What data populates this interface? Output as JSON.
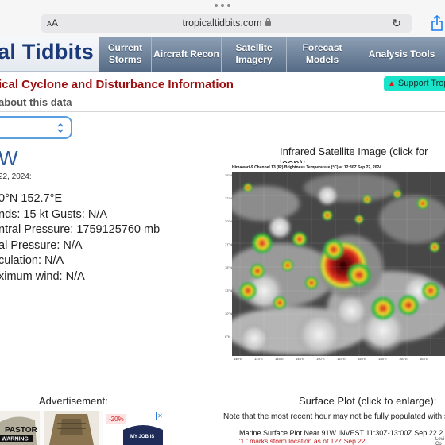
{
  "browser": {
    "aa_label": "AA",
    "url": "tropicaltidbits.com"
  },
  "site": {
    "logo_text": "al Tidbits",
    "nav": [
      {
        "label": "Current Storms"
      },
      {
        "label": "Aircraft Recon"
      },
      {
        "label": "Satellite Imagery"
      },
      {
        "label": "Forecast Models"
      },
      {
        "label": "Analysis Tools"
      }
    ]
  },
  "page": {
    "title": "ical Cyclone and Disturbance Information",
    "support_label": "Support Tropi",
    "about_link": "about this data"
  },
  "storm": {
    "name": "W",
    "as_of": "22, 2024:",
    "lines": [
      "0°N 152.7°E",
      "nds: 15 kt  Gusts: N/A",
      "ntral Pressure: 1759125760 mb",
      "al Pressure: N/A",
      "culation: N/A",
      "ximum wind: N/A"
    ]
  },
  "satellite": {
    "caption": "Infrared Satellite Image (click for loop):",
    "header": "Himawari-9 Channel 13 (IR) Brightness Temperature (°C) at 12:30Z Sep 22, 2024",
    "lat_labels": [
      "25°N",
      "22°N",
      "20°N",
      "17°N",
      "15°N",
      "13°N",
      "10°N",
      "8°N",
      "5°N"
    ],
    "lon_labels": [
      "140°E",
      "143°E",
      "145°E",
      "148°E",
      "150°E",
      "153°E",
      "155°E",
      "158°E",
      "160°E",
      "163°E",
      "165°E"
    ]
  },
  "advertisement": {
    "label": "Advertisement:",
    "badge_pct": "-20%",
    "hat_text_1": "PASTOR",
    "hat_text_2": "WARNING",
    "hat_text_3": "MY JOB IS"
  },
  "surface": {
    "caption": "Surface Plot (click to enlarge):",
    "note": "Note that the most recent hour may not be fully populated with sta",
    "plot_title": "Marine Surface Plot Near 91W INVEST 11:30Z-13:00Z Sep 22 2",
    "plot_subtitle": "\"L\" marks storm location as of 12Z Sep 22",
    "plot_corner": "Levi Co"
  },
  "colors": {
    "title_red": "#9b1010",
    "storm_blue": "#2c5a9a",
    "logo_navy": "#1b3a7a",
    "support_teal": "#19e3c8"
  }
}
